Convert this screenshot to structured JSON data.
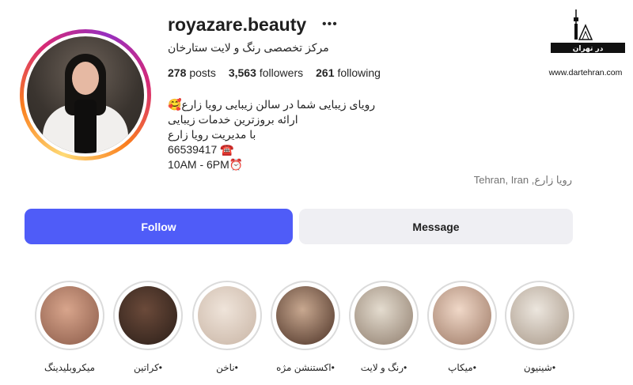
{
  "profile": {
    "username": "royazare.beauty",
    "full_name": "مرکز تخصصی رنگ و لایت ستارخان",
    "stats": {
      "posts_count": "278",
      "posts_label": "posts",
      "followers_count": "3,563",
      "followers_label": "followers",
      "following_count": "261",
      "following_label": "following"
    },
    "bio": [
      "رویای زیبایی شما در سالن زیبایی رویا زارع🥰",
      "ارائه بروزترین خدمات زیبایی",
      "با مدیریت رویا زارع",
      "66539417 ☎️",
      "10AM - 6PM⏰"
    ],
    "location": "Tehran, Iran ,رویا زارع"
  },
  "actions": {
    "follow": "Follow",
    "message": "Message"
  },
  "highlights": [
    {
      "label": "میکروبلیدینگ",
      "color1": "#d8a58c",
      "color2": "#8a5a48"
    },
    {
      "label": "•کراتین",
      "color1": "#6b4a3a",
      "color2": "#2a1e18"
    },
    {
      "label": "•ناخن",
      "color1": "#efe4da",
      "color2": "#c8b4a4"
    },
    {
      "label": "•اکستنشن مژه",
      "color1": "#c8a890",
      "color2": "#4a3024"
    },
    {
      "label": "•رنگ و لایت",
      "color1": "#e4dccf",
      "color2": "#8e7c6c"
    },
    {
      "label": "•میکاپ",
      "color1": "#f0d8c8",
      "color2": "#9c7864"
    },
    {
      "label": "•شینیون",
      "color1": "#ece6de",
      "color2": "#a89888"
    }
  ],
  "watermark": {
    "logo_text": "در تهران",
    "url": "www.dartehran.com"
  },
  "colors": {
    "follow_bg": "#4f5cf8",
    "message_bg": "#efeff3",
    "text": "#262626",
    "muted": "#737373"
  }
}
